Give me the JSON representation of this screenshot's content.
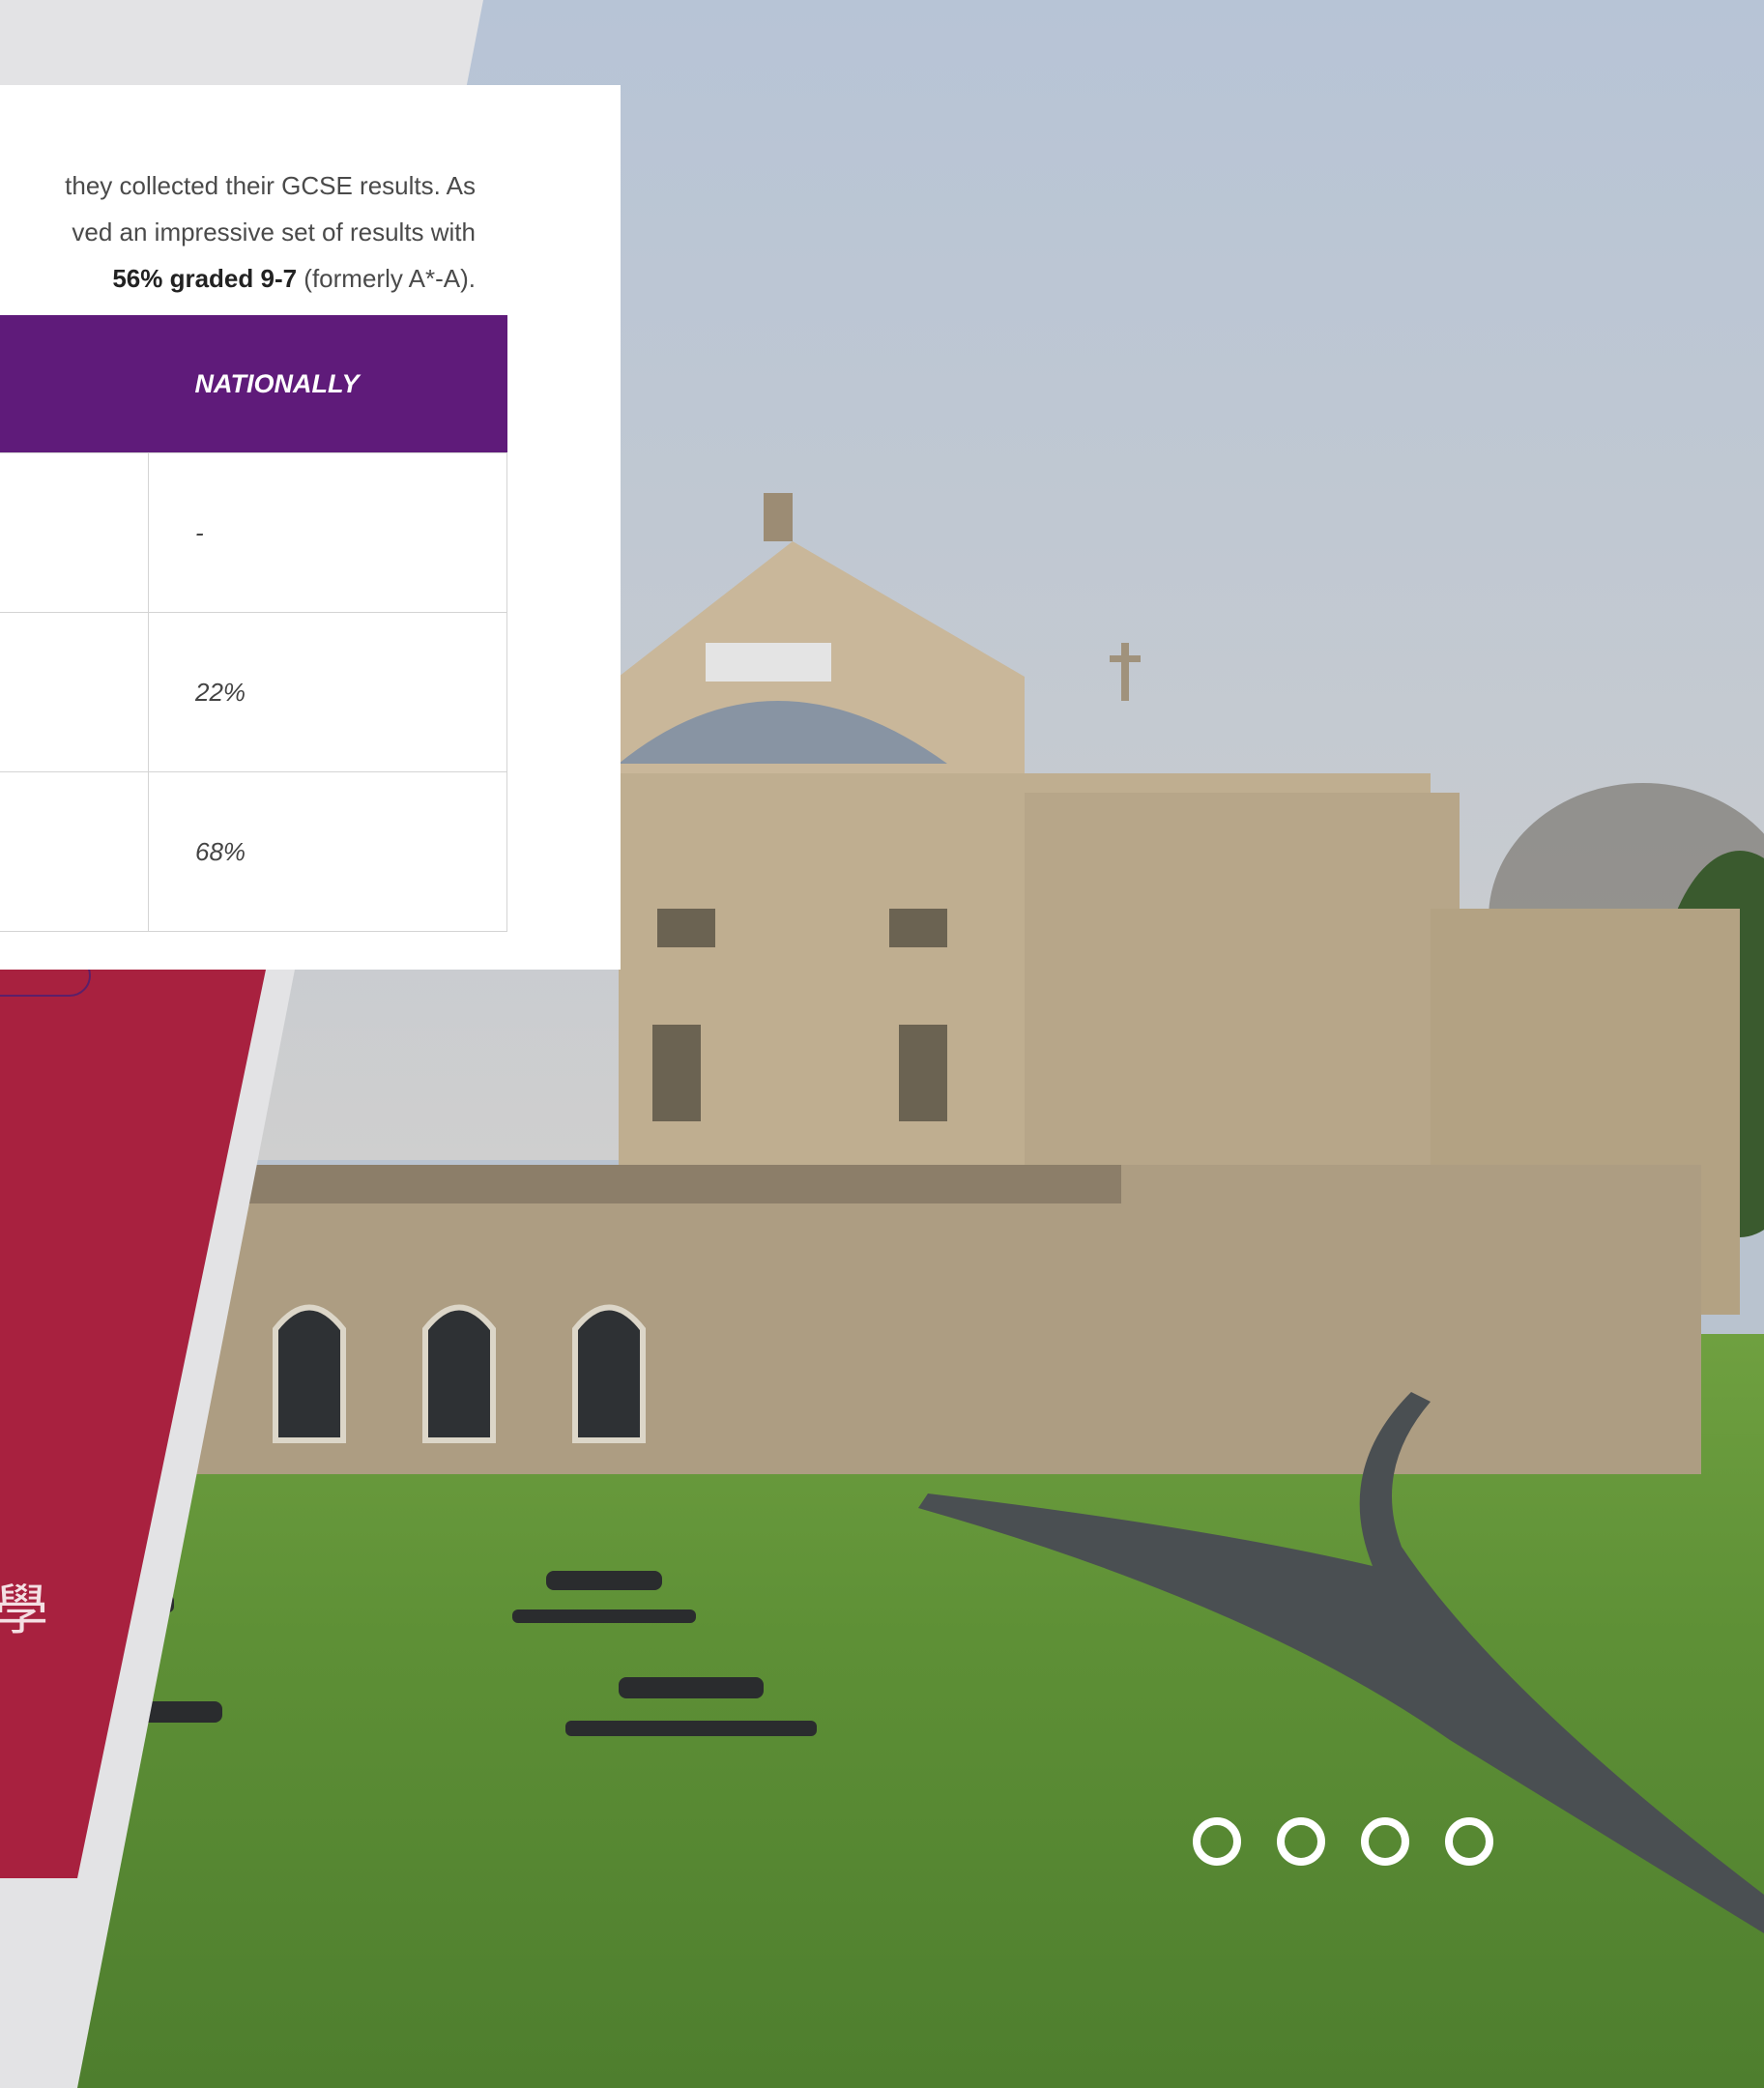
{
  "intro": {
    "line1": "they collected their GCSE results. As",
    "line2": "ved an impressive set of results with",
    "line3_bold": "56% graded 9-7",
    "line3_rest": " (formerly A*-A)."
  },
  "table": {
    "headers": [
      "",
      "NATIONALLY"
    ],
    "rows": [
      {
        "left": "",
        "nationally": "-"
      },
      {
        "left": "",
        "nationally": "22%"
      },
      {
        "left": "",
        "nationally": "68%"
      }
    ]
  },
  "red_panel": {
    "chinese_text": "學"
  },
  "carousel": {
    "dots": [
      "slide-1",
      "slide-2",
      "slide-3",
      "slide-4"
    ]
  },
  "colors": {
    "purple": "#5f1b7a",
    "crimson": "#a8213f",
    "card_bg": "#ffffff"
  }
}
